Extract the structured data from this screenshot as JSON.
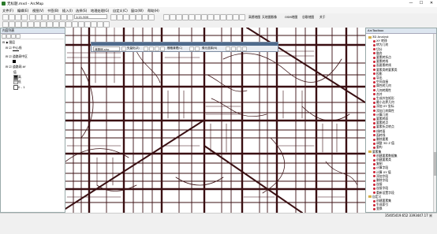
{
  "window": {
    "title": "无标题.mxd - ArcMap",
    "controls": [
      "—",
      "☐",
      "✕"
    ]
  },
  "menu": [
    "文件(F)",
    "编辑(E)",
    "视图(V)",
    "书签(B)",
    "插入(I)",
    "选择(S)",
    "地理处理(G)",
    "自定义(C)",
    "窗口(W)",
    "帮助(H)"
  ],
  "toolbar": {
    "scale": "1:21,500",
    "right_tabs": [
      "高德地图",
      "天地图影像",
      "OSM地图",
      "谷歌地图",
      "关于"
    ]
  },
  "float_toolbar": {
    "title": "编辑器",
    "layer_combo": "道路网.shp",
    "labels": [
      "矢量化(Z)",
      "栅格清理(C)",
      "像元选择(N)"
    ]
  },
  "toc": {
    "header": "内容列表",
    "items": [
      "图层",
      "中心线",
      "道路网中区",
      "道路网.tif",
      "值",
      "高",
      "低",
      "0 - 1"
    ]
  },
  "toolbox": {
    "header": "ArcToolbox",
    "items": [
      "3D Analyst",
      "XY 转线",
      "转为几何",
      "切分",
      "融合",
      "要素转折点",
      "要素转线",
      "面要素转线",
      "要素类转要素类",
      "投影",
      "导出",
      "空间连接",
      "属性转几何",
      "几何转属性",
      "合并",
      "生成外包矩形",
      "最小边界几何",
      "添加 XY 坐标",
      "添加几何属性",
      "计算几何",
      "要素转面",
      "要素转点",
      "要素折点转点",
      "线转面",
      "面转线",
      "删除要素",
      "调整 3D Z 值",
      "重构",
      "要素集",
      "创建要素数据集",
      "创建要素类",
      "复制",
      "计算字段",
      "计算 XY 值",
      "添加字段",
      "删除字段",
      "连接",
      "连接字段",
      "重新设置字段",
      "自定义",
      "创建要素集",
      "生成索引",
      "变换"
    ],
    "section_labels": [
      "遥感",
      "地理编码"
    ]
  },
  "status": {
    "coords": "35405419.652  3393447.17 米"
  }
}
